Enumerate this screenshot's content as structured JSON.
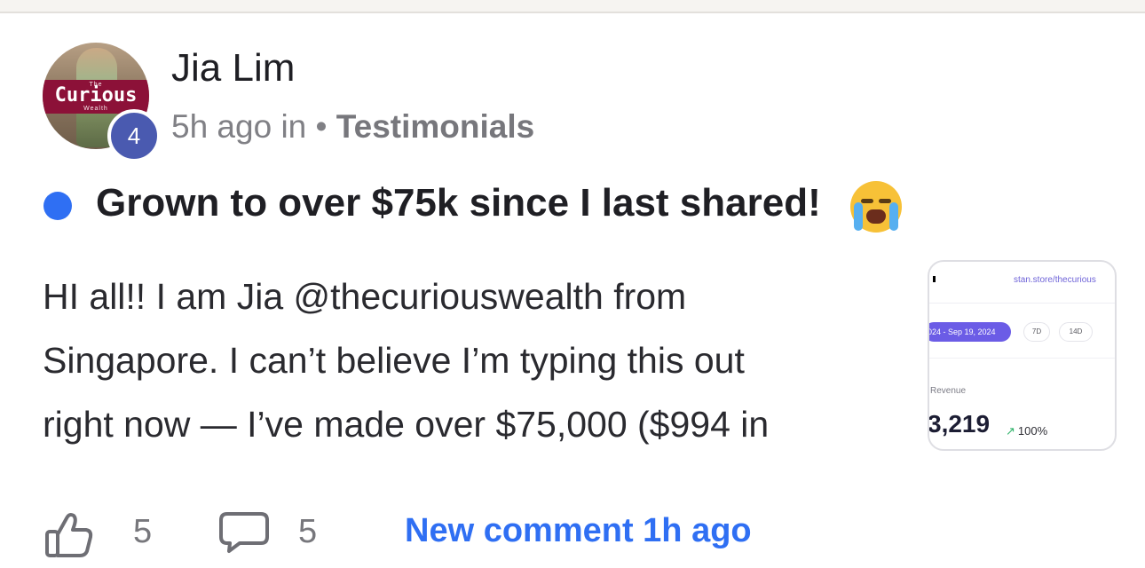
{
  "post": {
    "author": "Jia Lim",
    "level": "4",
    "time_ago": "5h ago in",
    "separator": "•",
    "space": "Testimonials",
    "title": "Grown to over $75k since I last shared!",
    "title_emoji": "loudly-crying-face",
    "body_lines": [
      "HI all!! I am Jia @thecuriouswealth from",
      "Singapore. I can’t believe I’m typing this out",
      "right now — I’ve made over $75,000 ($994 in"
    ],
    "likes": "5",
    "comments": "5",
    "new_comment": "New comment 1h ago"
  },
  "avatar": {
    "logo_small": "The",
    "logo_main": "Curious",
    "logo_sub": "Wealth"
  },
  "thumbnail": {
    "url": "stan.store/thecurious",
    "range": "024 - Sep 19, 2024",
    "chip_7d": "7D",
    "chip_14d": "14D",
    "revenue_label": "l Revenue",
    "revenue_value": "3,219",
    "trend": "100%"
  },
  "colors": {
    "accent_blue": "#2f6ff3",
    "badge": "#4a5ab0",
    "logo_band": "#8c1138",
    "thumb_accent": "#6b5ce6"
  }
}
